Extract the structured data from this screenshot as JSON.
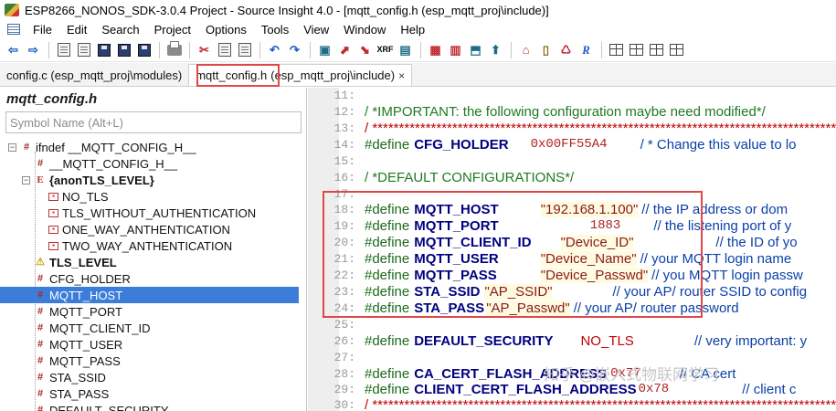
{
  "window": {
    "title": "ESP8266_NONOS_SDK-3.0.4 Project - Source Insight 4.0 - [mqtt_config.h (esp_mqtt_proj\\include)]"
  },
  "menu": [
    "File",
    "Edit",
    "Search",
    "Project",
    "Options",
    "Tools",
    "View",
    "Window",
    "Help"
  ],
  "toolbar": {
    "icons": [
      "back-arrow",
      "forward-arrow",
      "new-file",
      "open-file",
      "save",
      "save-all",
      "close",
      "print",
      "cut",
      "copy",
      "paste",
      "undo",
      "redo",
      "lookup",
      "jump-up",
      "jump-down",
      "xref",
      "symbol-window",
      "context",
      "browse",
      "bookmark",
      "relation",
      "layout"
    ],
    "xref_label": "XRF"
  },
  "tabs": [
    {
      "label": "config.c (esp_mqtt_proj\\modules)",
      "active": false
    },
    {
      "label": "mqtt_config.h",
      "active": true
    },
    {
      "label": "(esp_mqtt_proj\\include)",
      "active": true,
      "close": "×"
    }
  ],
  "symbol_pane": {
    "title": "mqtt_config.h",
    "search_placeholder": "Symbol Name (Alt+L)",
    "tree": [
      {
        "icon": "hash-icon",
        "label": "ifndef __MQTT_CONFIG_H__",
        "expander": "⊟",
        "bold": false,
        "selected": false
      },
      {
        "icon": "hash-icon",
        "label": "__MQTT_CONFIG_H__",
        "bold": false,
        "selected": false
      },
      {
        "icon": "enum-icon",
        "label": "{anonTLS_LEVEL}",
        "expander": "⊟",
        "bold": true,
        "selected": false
      },
      {
        "icon": "enum-member-icon",
        "label": "NO_TLS",
        "bold": false,
        "selected": false
      },
      {
        "icon": "enum-member-icon",
        "label": "TLS_WITHOUT_AUTHENTICATION",
        "bold": false,
        "selected": false
      },
      {
        "icon": "enum-member-icon",
        "label": "ONE_WAY_ANTHENTICATION",
        "bold": false,
        "selected": false
      },
      {
        "icon": "enum-member-icon",
        "label": "TWO_WAY_ANTHENTICATION",
        "bold": false,
        "selected": false
      },
      {
        "icon": "typedef-icon",
        "label": "TLS_LEVEL",
        "bold": true,
        "selected": false
      },
      {
        "icon": "hash-icon",
        "label": "CFG_HOLDER",
        "bold": false,
        "selected": false
      },
      {
        "icon": "hash-icon",
        "label": "MQTT_HOST",
        "bold": false,
        "selected": true
      },
      {
        "icon": "hash-icon",
        "label": "MQTT_PORT",
        "bold": false,
        "selected": false
      },
      {
        "icon": "hash-icon",
        "label": "MQTT_CLIENT_ID",
        "bold": false,
        "selected": false
      },
      {
        "icon": "hash-icon",
        "label": "MQTT_USER",
        "bold": false,
        "selected": false
      },
      {
        "icon": "hash-icon",
        "label": "MQTT_PASS",
        "bold": false,
        "selected": false
      },
      {
        "icon": "hash-icon",
        "label": "STA_SSID",
        "bold": false,
        "selected": false
      },
      {
        "icon": "hash-icon",
        "label": "STA_PASS",
        "bold": false,
        "selected": false
      },
      {
        "icon": "hash-icon",
        "label": "DEFAULT_SECURITY",
        "bold": false,
        "selected": false
      }
    ]
  },
  "editor": {
    "lines": [
      {
        "num": "11:"
      },
      {
        "num": "12:",
        "comment": "/ *IMPORTANT: the following configuration maybe need modified*/"
      },
      {
        "num": "13:",
        "comment": "/ *******************************************************************************************"
      },
      {
        "num": "14:",
        "keyword": "#define",
        "name": "CFG_HOLDER",
        "value": "0x00FF55A4",
        "comment": "/ * Change this value to lo"
      },
      {
        "num": "15:"
      },
      {
        "num": "16:",
        "comment": "/ *DEFAULT CONFIGURATIONS*/"
      },
      {
        "num": "17:"
      },
      {
        "num": "18:",
        "keyword": "#define",
        "name": "MQTT_HOST",
        "value": "\"192.168.1.100\"",
        "comment": "// the IP address or dom"
      },
      {
        "num": "19:",
        "keyword": "#define",
        "name": "MQTT_PORT",
        "value": "1883",
        "comment": "// the listening port of y"
      },
      {
        "num": "20:",
        "keyword": "#define",
        "name": "MQTT_CLIENT_ID",
        "value": "\"Device_ID\"",
        "comment": "// the ID of yo"
      },
      {
        "num": "21:",
        "keyword": "#define",
        "name": "MQTT_USER",
        "value": "\"Device_Name\"",
        "comment": "// your MQTT login name"
      },
      {
        "num": "22:",
        "keyword": "#define",
        "name": "MQTT_PASS",
        "value": "\"Device_Passwd\"",
        "comment": "// you MQTT login passw"
      },
      {
        "num": "23:",
        "keyword": "#define",
        "name": "STA_SSID",
        "value": "\"AP_SSID\"",
        "comment": "// your AP/ router SSID to config"
      },
      {
        "num": "24:",
        "keyword": "#define",
        "name": "STA_PASS",
        "value": "\"AP_Passwd\"",
        "comment": "// your AP/ router password"
      },
      {
        "num": "25:"
      },
      {
        "num": "26:",
        "keyword": "#define",
        "name": "DEFAULT_SECURITY",
        "value": "NO_TLS",
        "comment": "// very important: y"
      },
      {
        "num": "27:"
      },
      {
        "num": "28:",
        "keyword": "#define",
        "name": "CA_CERT_FLASH_ADDRESS",
        "value": "0x77",
        "comment": "// CA cert"
      },
      {
        "num": "29:",
        "keyword": "#define",
        "name": "CLIENT_CERT_FLASH_ADDRESS",
        "value": "0x78",
        "comment": "// client c"
      },
      {
        "num": "30:",
        "comment": "/ *******************************************************************************************"
      }
    ],
    "watermark": "知乎 @嵌入式物联网学习"
  },
  "colors": {
    "selection": "#3b7dd8",
    "annotation_border": "#e04848",
    "line_number": "#9a9a9a",
    "macro_name": "#000080",
    "comment": "#0b3fa8",
    "keyword": "#1a6a1a"
  }
}
